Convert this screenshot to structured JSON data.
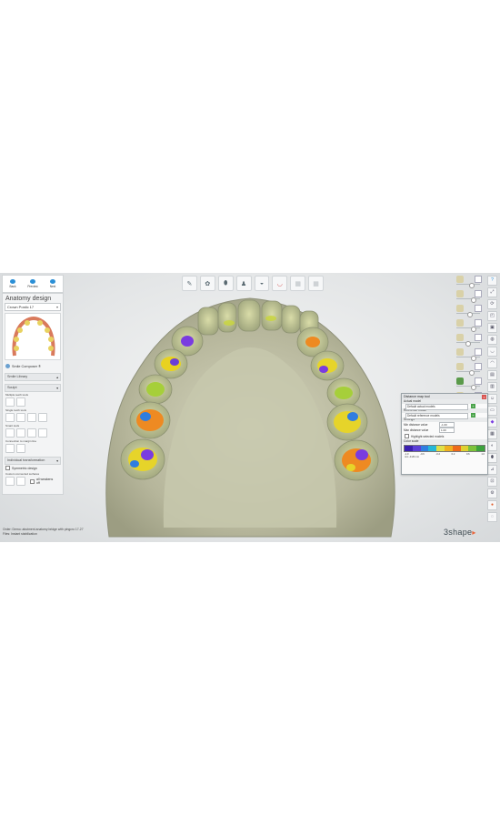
{
  "nav": {
    "back": "Back",
    "preview": "Preview",
    "next": "Next"
  },
  "panel": {
    "title": "Anatomy design",
    "dropdown": "Crown Postic 17",
    "composer": "Smile Composer ®",
    "smile_library": "Smile Library",
    "sculpt": "Sculpt",
    "multiple_tools": "Multiple teeth tools",
    "single_tools": "Single tooth tools",
    "smart_tools": "Smart tools",
    "connection_text": "Connection to margin line",
    "individual": "Individual transformation",
    "symmetric": "Symmetric design",
    "customized": "Custom connected surfaces",
    "all_weaken": "all weakens off"
  },
  "status": {
    "line1": "Order:   Demo: abutment anatomy bridge with pingcro 17-27",
    "line2": "Files:    Instant stabilization"
  },
  "logo": "3shape",
  "distance_tool": {
    "title": "Distance map tool",
    "actual_label": "Actual model",
    "actual_value": "Default actual models",
    "reference_label": "Reference model",
    "reference_value": "Default reference models",
    "settings_label": "Settings",
    "min_label": "Min distance value",
    "min_value": "-1.00",
    "max_label": "Max distance value",
    "max_value": "1.00",
    "highlight_label": "Highlight selected models",
    "color_scale_label": "Color scale",
    "ticks": [
      "-1.0",
      "-0.6",
      "-0.2",
      "0.2",
      "0.6",
      "1.0"
    ],
    "unit": "mm  -0.20 mm",
    "colors": [
      "#3a1fb0",
      "#5b3fd6",
      "#2f7de0",
      "#25b7d8",
      "#e0e048",
      "#f0b020",
      "#ee6a1a",
      "#e0d030",
      "#7cc23a",
      "#3ca23c"
    ]
  },
  "accent": "#2b8fd6"
}
